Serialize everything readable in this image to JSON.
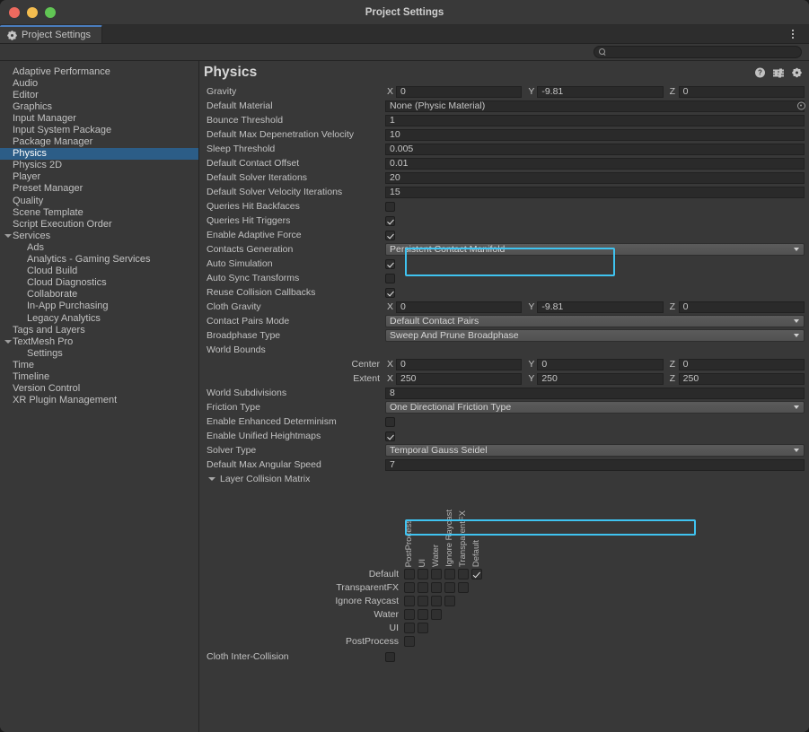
{
  "window": {
    "title": "Project Settings",
    "traffic_lights": [
      "close-red",
      "minimize-yellow",
      "zoom-green"
    ]
  },
  "tab": {
    "label": "Project Settings",
    "icon": "gear-icon",
    "options_icon": "kebab-menu-icon"
  },
  "search": {
    "value": "",
    "placeholder": "",
    "icon": "search-icon"
  },
  "sidebar": {
    "items": [
      {
        "label": "Adaptive Performance",
        "indent": 0,
        "selected": false,
        "arrow": false
      },
      {
        "label": "Audio",
        "indent": 0,
        "selected": false,
        "arrow": false
      },
      {
        "label": "Editor",
        "indent": 0,
        "selected": false,
        "arrow": false
      },
      {
        "label": "Graphics",
        "indent": 0,
        "selected": false,
        "arrow": false
      },
      {
        "label": "Input Manager",
        "indent": 0,
        "selected": false,
        "arrow": false
      },
      {
        "label": "Input System Package",
        "indent": 0,
        "selected": false,
        "arrow": false
      },
      {
        "label": "Package Manager",
        "indent": 0,
        "selected": false,
        "arrow": false
      },
      {
        "label": "Physics",
        "indent": 0,
        "selected": true,
        "arrow": false
      },
      {
        "label": "Physics 2D",
        "indent": 0,
        "selected": false,
        "arrow": false
      },
      {
        "label": "Player",
        "indent": 0,
        "selected": false,
        "arrow": false
      },
      {
        "label": "Preset Manager",
        "indent": 0,
        "selected": false,
        "arrow": false
      },
      {
        "label": "Quality",
        "indent": 0,
        "selected": false,
        "arrow": false
      },
      {
        "label": "Scene Template",
        "indent": 0,
        "selected": false,
        "arrow": false
      },
      {
        "label": "Script Execution Order",
        "indent": 0,
        "selected": false,
        "arrow": false
      },
      {
        "label": "Services",
        "indent": 0,
        "selected": false,
        "arrow": true
      },
      {
        "label": "Ads",
        "indent": 1,
        "selected": false,
        "arrow": false
      },
      {
        "label": "Analytics - Gaming Services",
        "indent": 1,
        "selected": false,
        "arrow": false
      },
      {
        "label": "Cloud Build",
        "indent": 1,
        "selected": false,
        "arrow": false
      },
      {
        "label": "Cloud Diagnostics",
        "indent": 1,
        "selected": false,
        "arrow": false
      },
      {
        "label": "Collaborate",
        "indent": 1,
        "selected": false,
        "arrow": false
      },
      {
        "label": "In-App Purchasing",
        "indent": 1,
        "selected": false,
        "arrow": false
      },
      {
        "label": "Legacy Analytics",
        "indent": 1,
        "selected": false,
        "arrow": false
      },
      {
        "label": "Tags and Layers",
        "indent": 0,
        "selected": false,
        "arrow": false
      },
      {
        "label": "TextMesh Pro",
        "indent": 0,
        "selected": false,
        "arrow": true
      },
      {
        "label": "Settings",
        "indent": 1,
        "selected": false,
        "arrow": false
      },
      {
        "label": "Time",
        "indent": 0,
        "selected": false,
        "arrow": false
      },
      {
        "label": "Timeline",
        "indent": 0,
        "selected": false,
        "arrow": false
      },
      {
        "label": "Version Control",
        "indent": 0,
        "selected": false,
        "arrow": false
      },
      {
        "label": "XR Plugin Management",
        "indent": 0,
        "selected": false,
        "arrow": false
      }
    ]
  },
  "main": {
    "title": "Physics",
    "header_icons": [
      "help-icon",
      "preset-icon",
      "gear-icon"
    ],
    "properties": {
      "gravity": {
        "label": "Gravity",
        "x_label": "X",
        "x": "0",
        "y_label": "Y",
        "y": "-9.81",
        "z_label": "Z",
        "z": "0"
      },
      "default_material": {
        "label": "Default Material",
        "value": "None (Physic Material)",
        "picker_icon": "object-picker-icon"
      },
      "bounce_threshold": {
        "label": "Bounce Threshold",
        "value": "1"
      },
      "default_max_depenetration_velocity": {
        "label": "Default Max Depenetration Velocity",
        "value": "10"
      },
      "sleep_threshold": {
        "label": "Sleep Threshold",
        "value": "0.005"
      },
      "default_contact_offset": {
        "label": "Default Contact Offset",
        "value": "0.01"
      },
      "default_solver_iterations": {
        "label": "Default Solver Iterations",
        "value": "20",
        "highlighted": true
      },
      "default_solver_velocity_iterations": {
        "label": "Default Solver Velocity Iterations",
        "value": "15",
        "highlighted": true
      },
      "queries_hit_backfaces": {
        "label": "Queries Hit Backfaces",
        "checked": false
      },
      "queries_hit_triggers": {
        "label": "Queries Hit Triggers",
        "checked": true
      },
      "enable_adaptive_force": {
        "label": "Enable Adaptive Force",
        "checked": true
      },
      "contacts_generation": {
        "label": "Contacts Generation",
        "value": "Persistent Contact Manifold"
      },
      "auto_simulation": {
        "label": "Auto Simulation",
        "checked": true
      },
      "auto_sync_transforms": {
        "label": "Auto Sync Transforms",
        "checked": false
      },
      "reuse_collision_callbacks": {
        "label": "Reuse Collision Callbacks",
        "checked": true
      },
      "cloth_gravity": {
        "label": "Cloth Gravity",
        "x_label": "X",
        "x": "0",
        "y_label": "Y",
        "y": "-9.81",
        "z_label": "Z",
        "z": "0"
      },
      "contact_pairs_mode": {
        "label": "Contact Pairs Mode",
        "value": "Default Contact Pairs"
      },
      "broadphase_type": {
        "label": "Broadphase Type",
        "value": "Sweep And Prune Broadphase"
      },
      "world_bounds": {
        "label": "World Bounds"
      },
      "world_bounds_center": {
        "label": "Center",
        "x_label": "X",
        "x": "0",
        "y_label": "Y",
        "y": "0",
        "z_label": "Z",
        "z": "0"
      },
      "world_bounds_extent": {
        "label": "Extent",
        "x_label": "X",
        "x": "250",
        "y_label": "Y",
        "y": "250",
        "z_label": "Z",
        "z": "250"
      },
      "world_subdivisions": {
        "label": "World Subdivisions",
        "value": "8"
      },
      "friction_type": {
        "label": "Friction Type",
        "value": "One Directional Friction Type"
      },
      "enable_enhanced_determinism": {
        "label": "Enable Enhanced Determinism",
        "checked": false
      },
      "enable_unified_heightmaps": {
        "label": "Enable Unified Heightmaps",
        "checked": true
      },
      "solver_type": {
        "label": "Solver Type",
        "value": "Temporal Gauss Seidel",
        "highlighted": true
      },
      "default_max_angular_speed": {
        "label": "Default Max Angular Speed",
        "value": "7"
      },
      "layer_collision_matrix": {
        "label": "Layer Collision Matrix",
        "expanded": true
      },
      "cloth_inter_collision": {
        "label": "Cloth Inter-Collision",
        "checked": false
      }
    },
    "layer_matrix": {
      "column_labels": [
        "PostProcess",
        "UI",
        "Water",
        "Ignore Raycast",
        "TransparentFX",
        "Default"
      ],
      "rows": [
        {
          "label": "Default",
          "cells": [
            false,
            false,
            false,
            false,
            false,
            true
          ]
        },
        {
          "label": "TransparentFX",
          "cells": [
            false,
            false,
            false,
            false,
            false
          ]
        },
        {
          "label": "Ignore Raycast",
          "cells": [
            false,
            false,
            false,
            false
          ]
        },
        {
          "label": "Water",
          "cells": [
            false,
            false,
            false
          ]
        },
        {
          "label": "UI",
          "cells": [
            false,
            false
          ]
        },
        {
          "label": "PostProcess",
          "cells": [
            false
          ]
        }
      ]
    }
  },
  "colors": {
    "accent_selection": "#2c5d87",
    "highlight_outline": "#3fc3f0",
    "tab_active_border": "#4a7dbd",
    "panel_bg": "#383838",
    "field_bg": "#2a2a2a"
  }
}
